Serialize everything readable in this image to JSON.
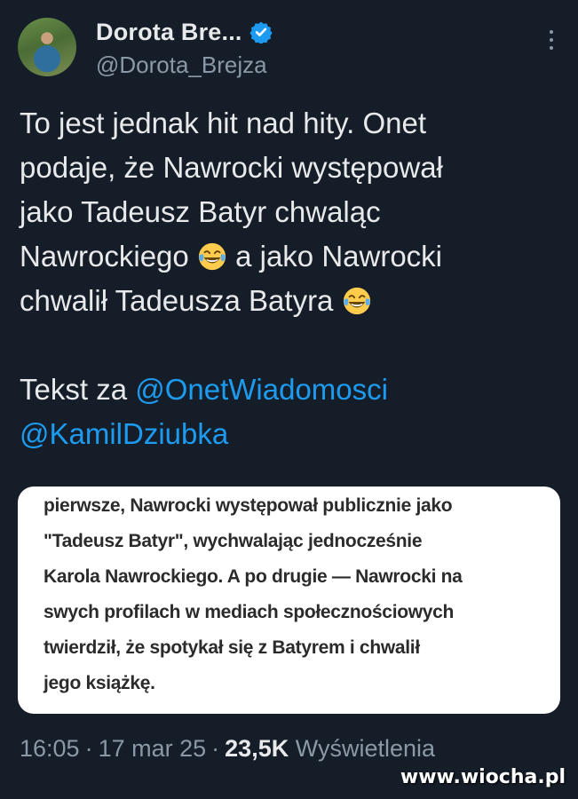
{
  "author": {
    "display_name": "Dorota Bre...",
    "handle": "@Dorota_Brejza",
    "verified": true
  },
  "tweet": {
    "lines": [
      "To jest jednak hit nad hity. Onet",
      "podaje, że Nawrocki występował",
      "jako Tadeusz Batyr chwaląc"
    ],
    "line4_before_emoji": "Nawrockiego ",
    "line4_after_emoji": " a jako Nawrocki",
    "line5_before_emoji": "chwalił Tadeusza Batyra ",
    "text_prefix": "Tekst za ",
    "mention_1": "@OnetWiadomosci",
    "mention_2": "@KamilDziubka",
    "emoji_name": "face-with-tears-of-joy"
  },
  "quote": {
    "lines": [
      "pierwsze, Nawrocki występował publicznie jako",
      "\"Tadeusz Batyr\", wychwalając jednocześnie",
      "Karola Nawrockiego. A po drugie — Nawrocki na",
      "swych profilach w mediach społecznościowych",
      "twierdził, że spotykał się z Batyrem i chwalił",
      "jego książkę."
    ]
  },
  "meta": {
    "time": "16:05",
    "date": "17 mar 25",
    "views_count": "23,5K",
    "views_label": "Wyświetlenia"
  },
  "watermark": "www.wiocha.pl",
  "colors": {
    "background": "#151d28",
    "text": "#e7e9ea",
    "secondary": "#8b98a5",
    "link": "#1d9bf0",
    "verified": "#1d9bf0"
  }
}
